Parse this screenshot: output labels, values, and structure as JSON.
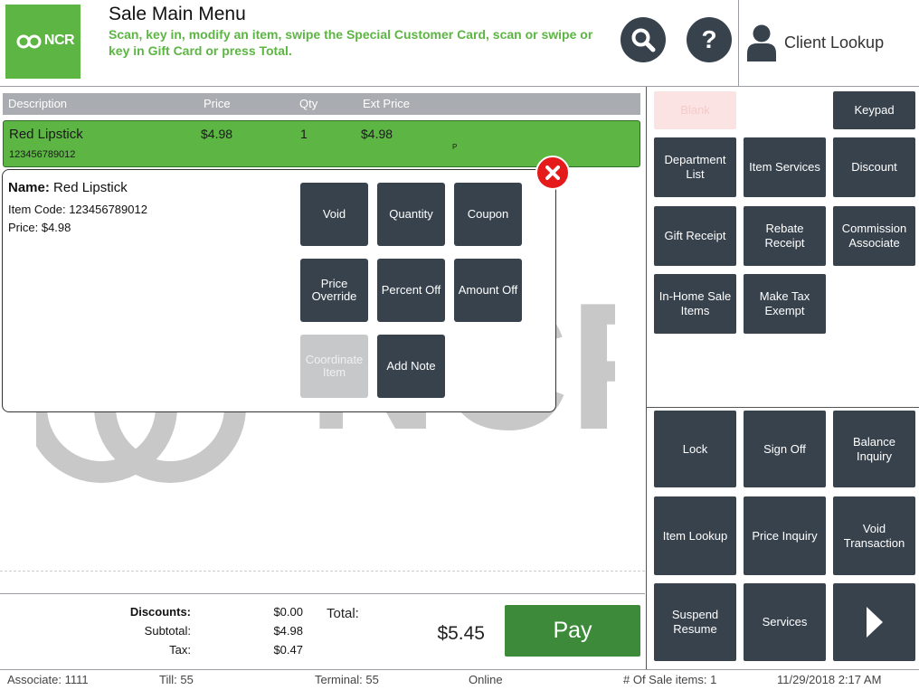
{
  "header": {
    "logo_text": "NCR",
    "title": "Sale Main Menu",
    "instructions": "Scan, key in, modify an item, swipe the Special Customer Card, scan or swipe or key in Gift Card or press Total.",
    "search_icon": "search-icon",
    "help_label": "?",
    "client_lookup_label": "Client Lookup"
  },
  "item_list": {
    "columns": [
      "Description",
      "Price",
      "Qty",
      "Ext Price"
    ],
    "rows": [
      {
        "description": "Red Lipstick",
        "code": "123456789012",
        "price": "$4.98",
        "qty": "1",
        "ext_price": "$4.98",
        "flag": "P"
      }
    ]
  },
  "popup": {
    "name_label": "Name:",
    "name_value": "Red Lipstick",
    "code_line": "Item Code: 123456789012",
    "price_line": "Price: $4.98",
    "buttons": [
      "Void",
      "Quantity",
      "Coupon",
      "Price Override",
      "Percent Off",
      "Amount Off",
      "Coordinate Item",
      "Add Note"
    ]
  },
  "watermark_text": "NCR",
  "totals": {
    "discounts_label": "Discounts:",
    "discounts_value": "$0.00",
    "subtotal_label": "Subtotal:",
    "subtotal_value": "$4.98",
    "tax_label": "Tax:",
    "tax_value": "$0.47",
    "total_label": "Total:",
    "total_value": "$5.45",
    "pay_label": "Pay"
  },
  "right_top": {
    "blank_label": "Blank",
    "keypad": "Keypad",
    "department_list": "Department List",
    "item_services": "Item Services",
    "discount": "Discount",
    "gift_receipt": "Gift Receipt",
    "rebate_receipt": "Rebate Receipt",
    "commission_associate": "Commission Associate",
    "in_home_sale_items": "In-Home Sale Items",
    "make_tax_exempt": "Make Tax Exempt"
  },
  "right_bottom": {
    "lock": "Lock",
    "sign_off": "Sign Off",
    "balance_inquiry": "Balance Inquiry",
    "item_lookup": "Item Lookup",
    "price_inquiry": "Price Inquiry",
    "void_transaction": "Void Transaction",
    "suspend_resume": "Suspend Resume",
    "services": "Services",
    "next_icon": "chevron-right-icon"
  },
  "status": {
    "associate": "Associate: 1111",
    "till": "Till: 55",
    "terminal": "Terminal: 55",
    "online": "Online",
    "sale_items": "# Of Sale items: 1",
    "datetime": "11/29/2018 2:17 AM"
  },
  "colors": {
    "brand_green": "#5db544",
    "button_dark": "#37424d",
    "pay_green": "#3d8b3a",
    "close_red": "#e51b1b"
  }
}
